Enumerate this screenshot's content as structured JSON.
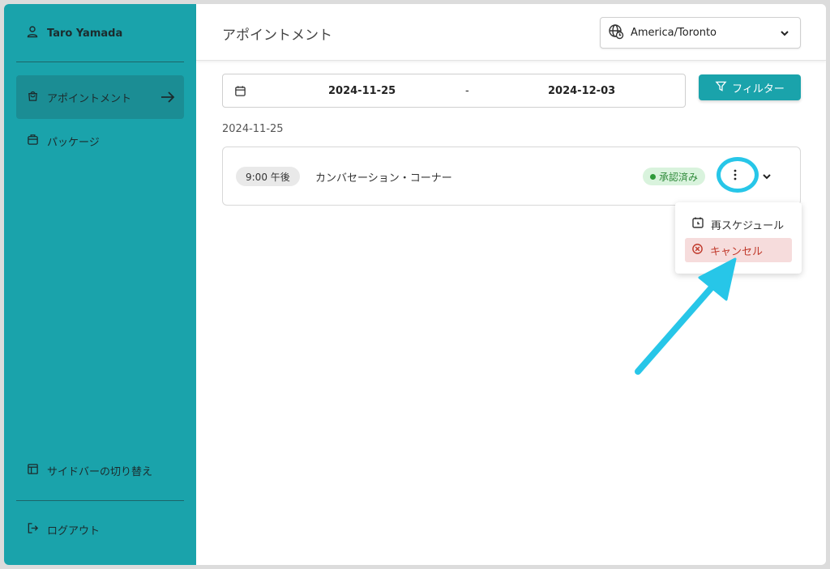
{
  "user": {
    "name": "Taro Yamada",
    "icon": "user-icon"
  },
  "sidebar": {
    "items": [
      {
        "label": "アポイントメント",
        "icon": "shopping-bag-icon",
        "active": true
      },
      {
        "label": "パッケージ",
        "icon": "package-icon",
        "active": false
      }
    ],
    "toggle_label": "サイドバーの切り替え",
    "logout_label": "ログアウト"
  },
  "header": {
    "title": "アポイントメント",
    "timezone": {
      "value": "America/Toronto",
      "icon": "globe-clock-icon"
    }
  },
  "filters": {
    "start_date": "2024-11-25",
    "separator": "-",
    "end_date": "2024-12-03",
    "filter_label": "フィルター"
  },
  "appointments": {
    "group_date": "2024-11-25",
    "items": [
      {
        "time": "9:00 午後",
        "title": "カンバセーション・コーナー",
        "status": "承認済み"
      }
    ]
  },
  "menu": {
    "reschedule_label": "再スケジュール",
    "cancel_label": "キャンセル"
  },
  "colors": {
    "sidebar": "#1aa3ab",
    "accent": "#1aa3ab",
    "highlight": "#27c6e8",
    "danger": "#c0392b"
  }
}
